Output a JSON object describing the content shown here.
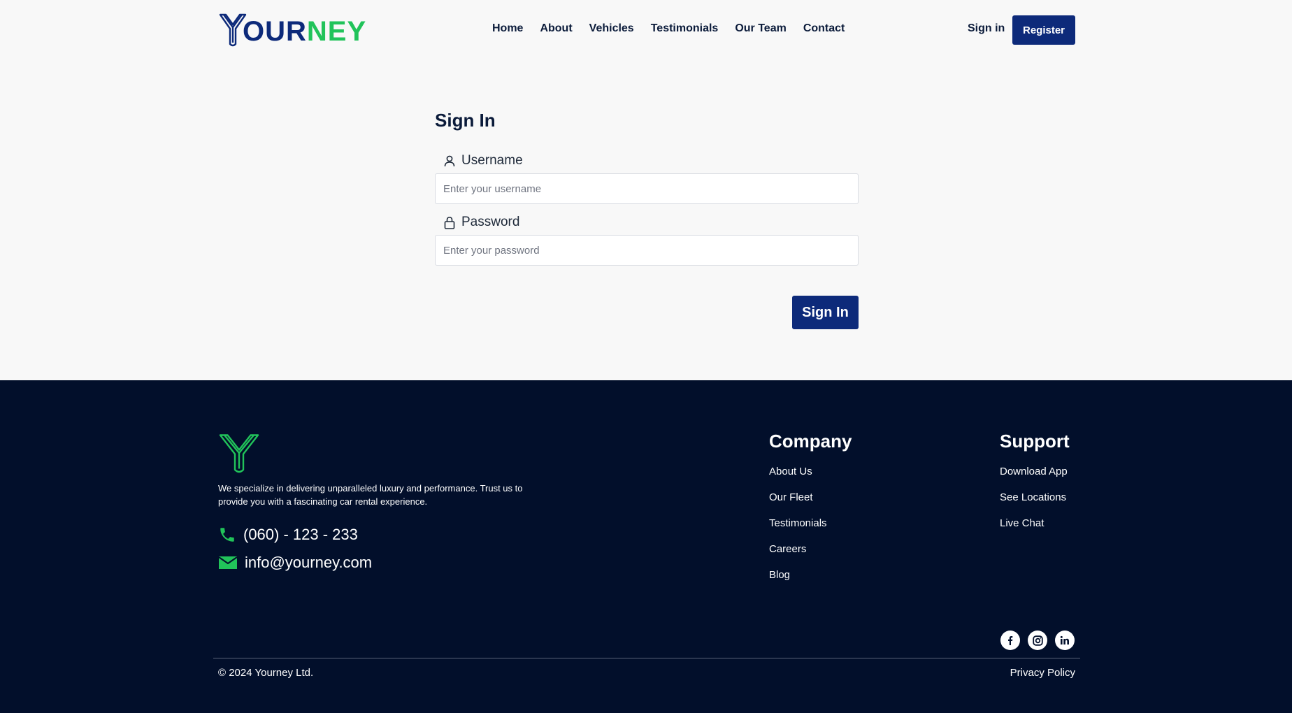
{
  "colors": {
    "brand_navy": "#0d2a7a",
    "brand_green": "#21c35a",
    "footer_bg": "#020f2b",
    "page_bg": "#f8f8f8"
  },
  "header": {
    "logo": {
      "text_our": "OUR",
      "text_ney": "NEY",
      "icon": "y-logo-icon"
    },
    "nav": [
      "Home",
      "About",
      "Vehicles",
      "Testimonials",
      "Our Team",
      "Contact"
    ],
    "signin": "Sign in",
    "register": "Register"
  },
  "form": {
    "title": "Sign In",
    "username_label": "Username",
    "username_placeholder": "Enter your username",
    "password_label": "Password",
    "password_placeholder": "Enter your password",
    "submit": "Sign In"
  },
  "footer": {
    "description": "We specialize in delivering unparalleled luxury and performance. Trust us to provide you with a fascinating car rental experience.",
    "phone": "(060) - 123 - 233",
    "email": "info@yourney.com",
    "company": {
      "title": "Company",
      "links": [
        "About Us",
        "Our Fleet",
        "Testimonials",
        "Careers",
        "Blog"
      ]
    },
    "support": {
      "title": "Support",
      "links": [
        "Download App",
        "See Locations",
        "Live Chat"
      ]
    },
    "socials": [
      "facebook-icon",
      "instagram-icon",
      "linkedin-icon"
    ],
    "copyright": "© 2024 Yourney Ltd.",
    "privacy": "Privacy Policy"
  }
}
